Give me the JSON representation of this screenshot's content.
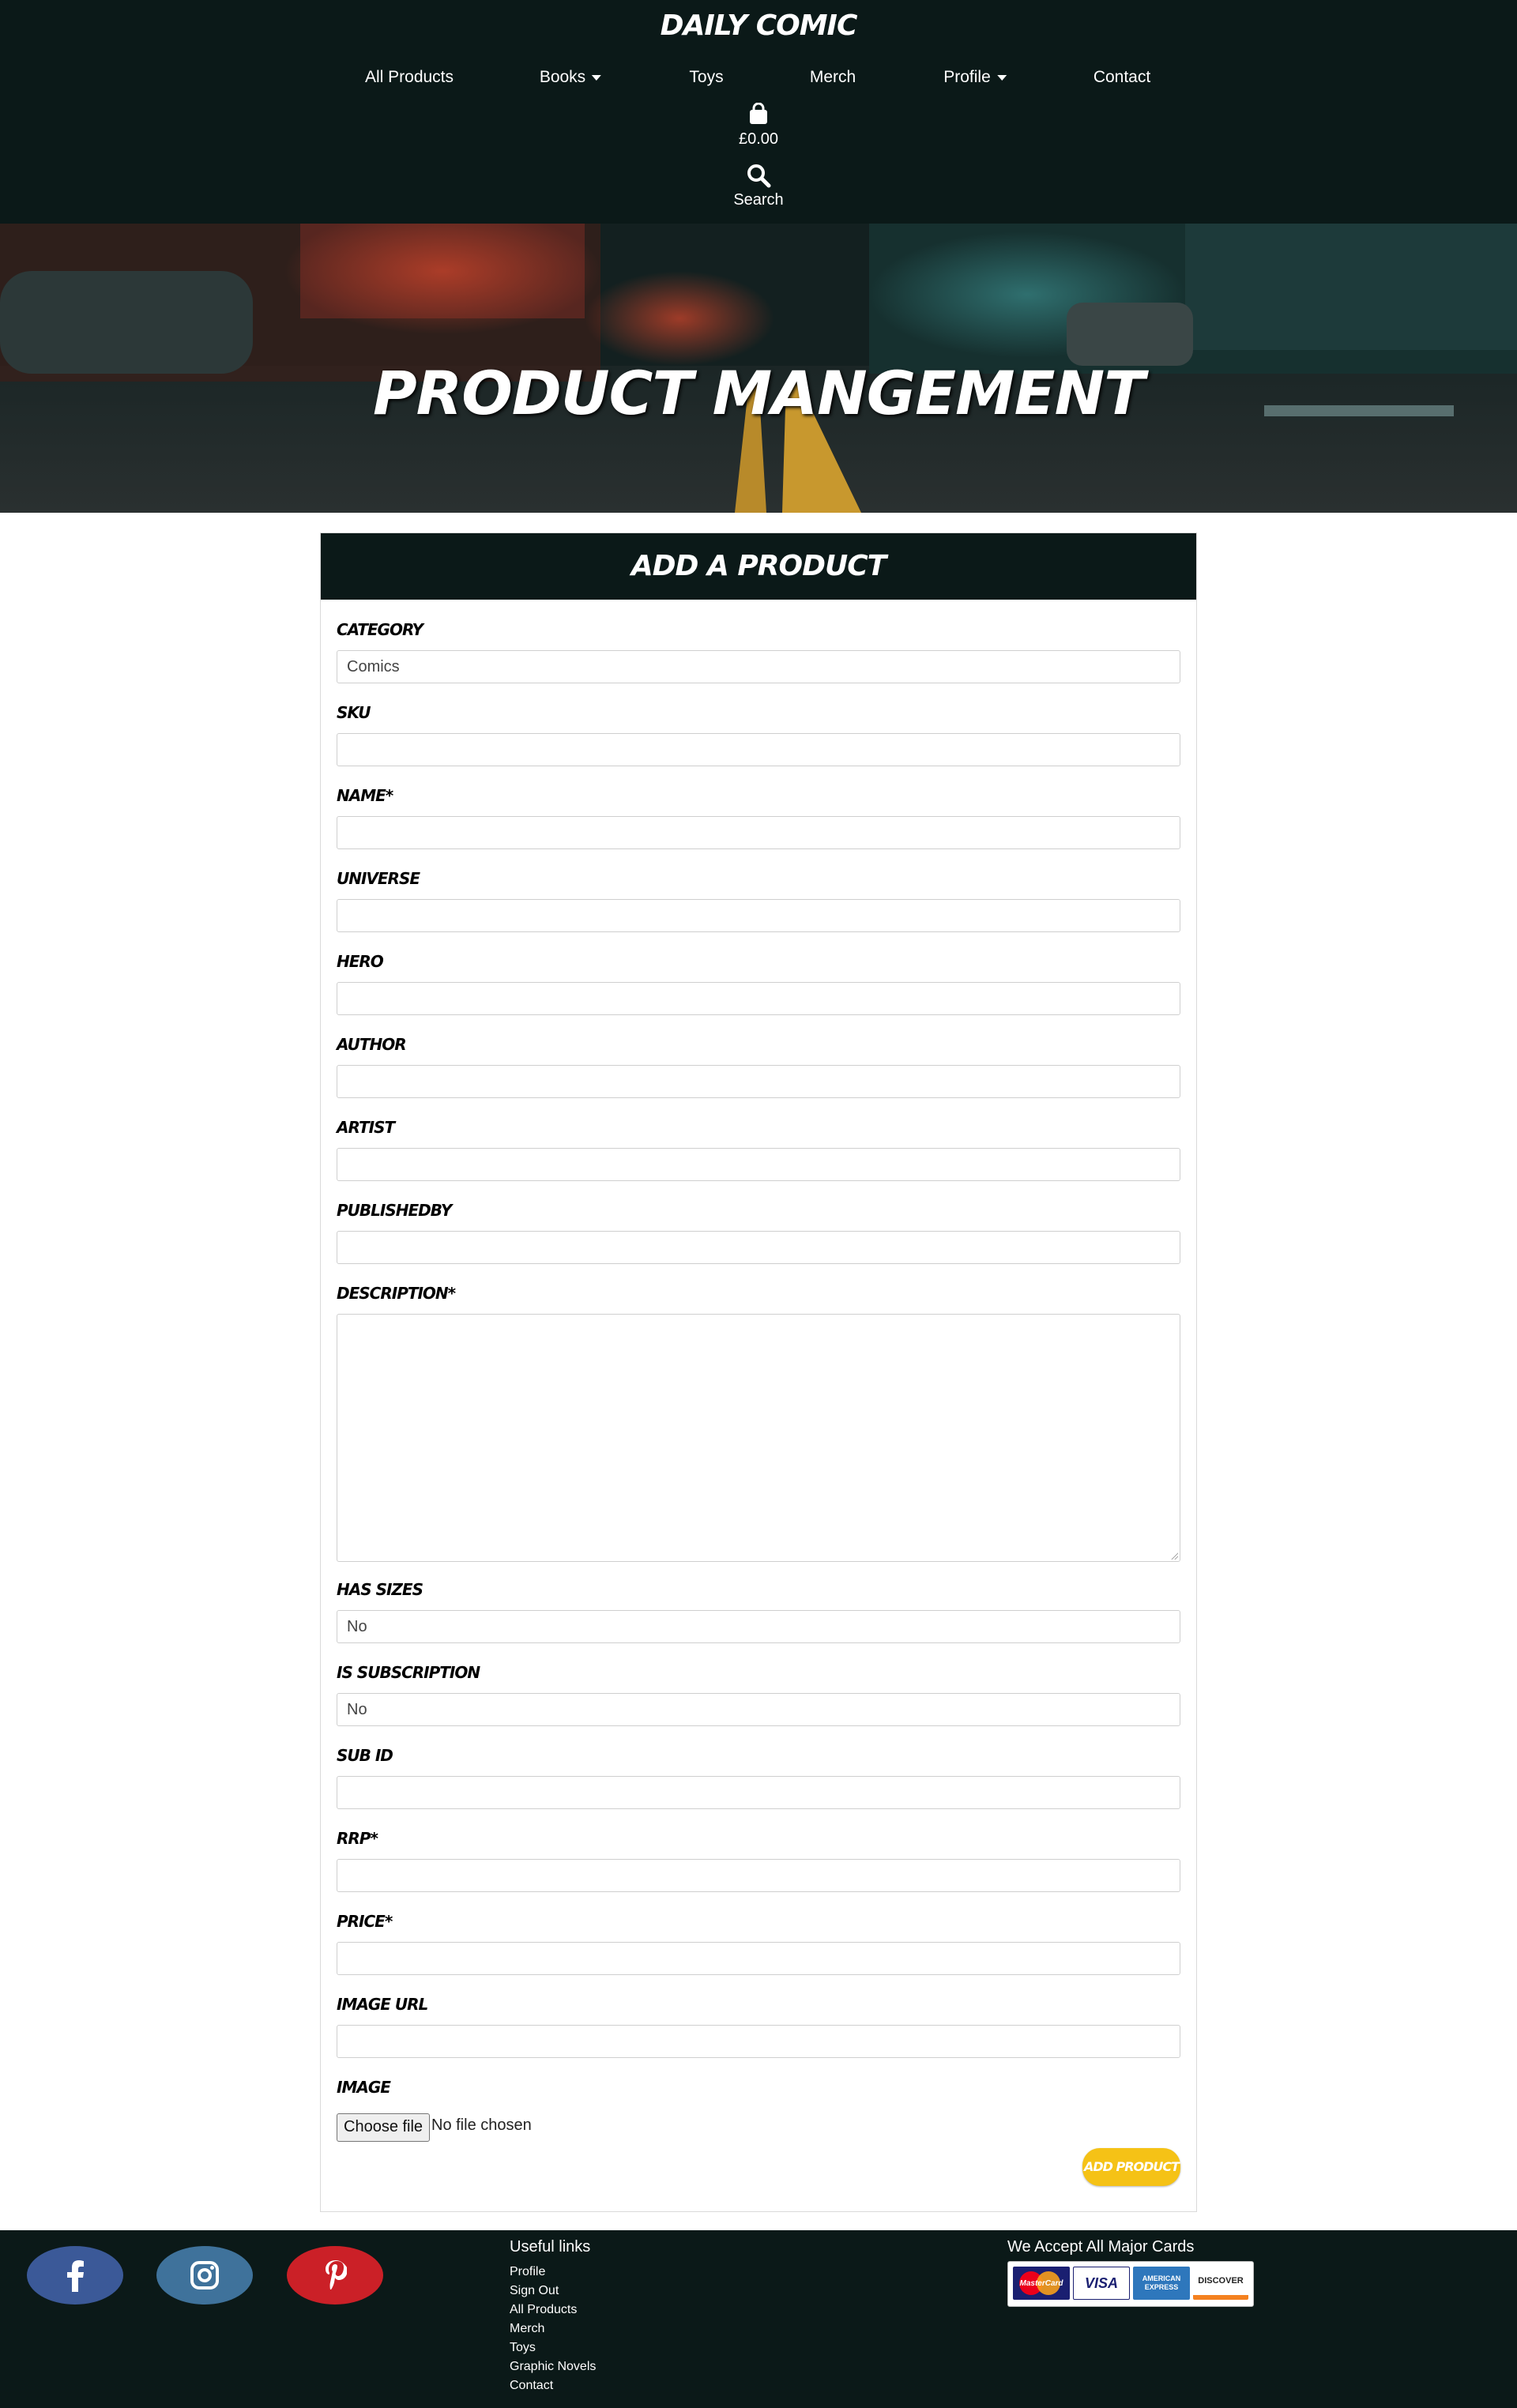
{
  "header": {
    "brand": "DAILY COMIC",
    "nav": {
      "all_products": "All Products",
      "books": "Books",
      "toys": "Toys",
      "merch": "Merch",
      "profile": "Profile",
      "contact": "Contact"
    },
    "cart_total": "£0.00",
    "search_label": "Search"
  },
  "hero": {
    "title": "PRODUCT MANGEMENT"
  },
  "form": {
    "title": "ADD A PRODUCT",
    "fields": {
      "category": {
        "label": "CATEGORY",
        "value": "Comics"
      },
      "sku": {
        "label": "SKU",
        "value": ""
      },
      "name": {
        "label": "NAME*",
        "value": ""
      },
      "universe": {
        "label": "UNIVERSE",
        "value": ""
      },
      "hero": {
        "label": "HERO",
        "value": ""
      },
      "author": {
        "label": "AUTHOR",
        "value": ""
      },
      "artist": {
        "label": "ARTIST",
        "value": ""
      },
      "publishedby": {
        "label": "PUBLISHEDBY",
        "value": ""
      },
      "description": {
        "label": "DESCRIPTION*",
        "value": ""
      },
      "has_sizes": {
        "label": "HAS SIZES",
        "value": "No"
      },
      "is_subscription": {
        "label": "IS SUBSCRIPTION",
        "value": "No"
      },
      "sub_id": {
        "label": "SUB ID",
        "value": ""
      },
      "rrp": {
        "label": "RRP*",
        "value": ""
      },
      "price": {
        "label": "PRICE*",
        "value": ""
      },
      "image_url": {
        "label": "IMAGE URL",
        "value": ""
      },
      "image": {
        "label": "IMAGE",
        "button": "Choose file",
        "status": "No file chosen"
      }
    },
    "submit": "ADD PRODUCT"
  },
  "footer": {
    "social": [
      "facebook-icon",
      "instagram-icon",
      "pinterest-icon"
    ],
    "useful_links_title": "Useful links",
    "links": [
      "Profile",
      "Sign Out",
      "All Products",
      "Merch",
      "Toys",
      "Graphic Novels",
      "Contact"
    ],
    "cards_title": "We Accept All Major Cards",
    "cards": [
      "MasterCard",
      "VISA",
      "AMERICAN EXPRESS",
      "DISCOVER"
    ]
  },
  "colors": {
    "dark": "#0b1918",
    "accent": "#f5c216",
    "facebook": "#3b5998",
    "instagram": "#3f729b",
    "pinterest": "#cb2027"
  }
}
